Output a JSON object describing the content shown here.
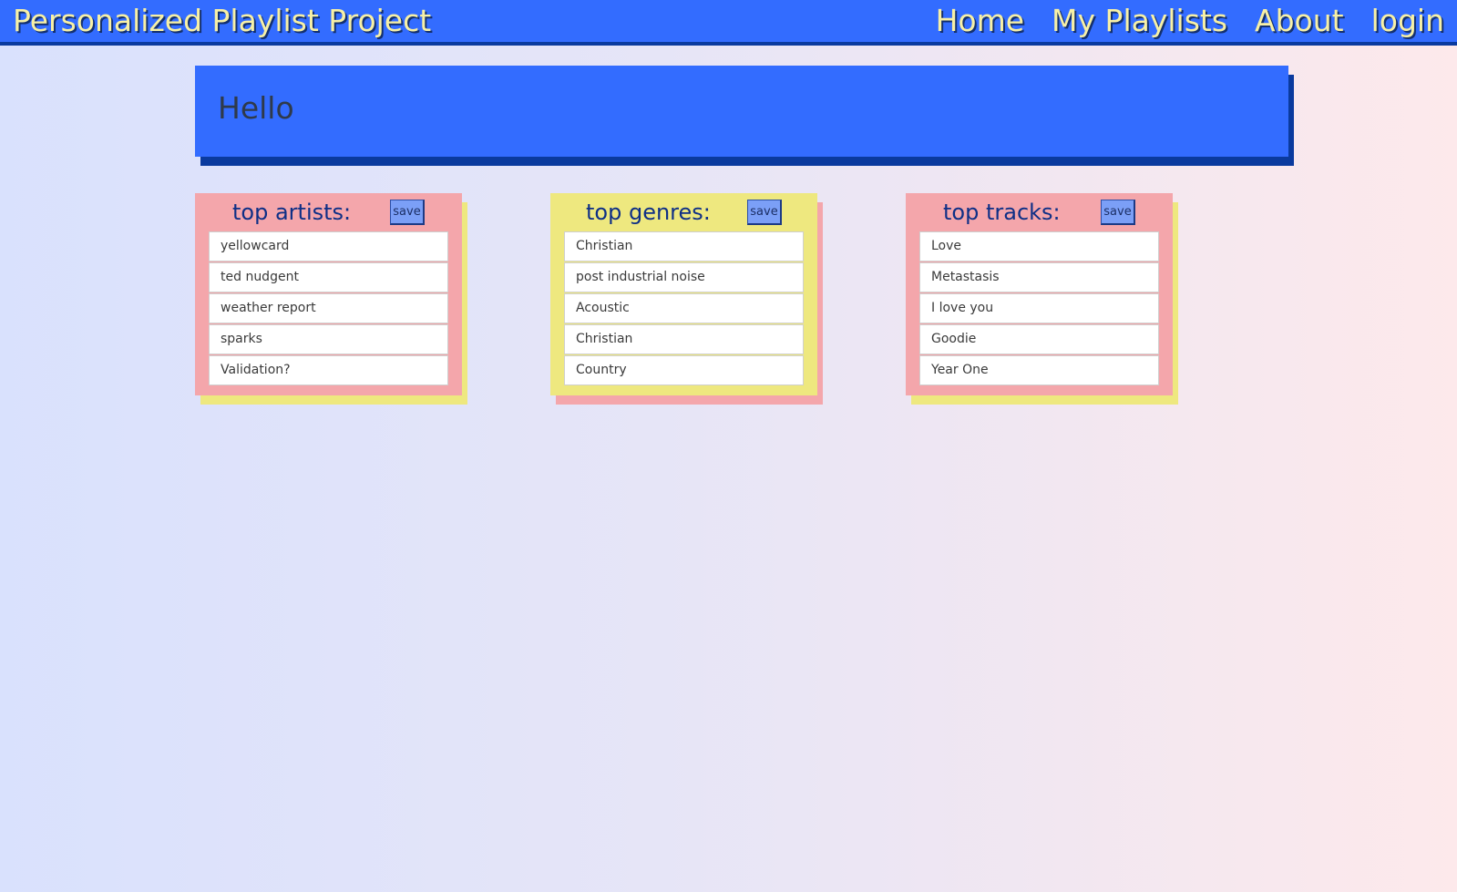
{
  "navbar": {
    "brand": "Personalized Playlist Project",
    "links": [
      "Home",
      "My Playlists",
      "About",
      "login"
    ]
  },
  "hero": {
    "greeting": "Hello"
  },
  "cards": [
    {
      "title": "top artists:",
      "save_label": "save",
      "items": [
        "yellowcard",
        "ted nudgent",
        "weather report",
        "sparks",
        "Validation?"
      ]
    },
    {
      "title": "top genres:",
      "save_label": "save",
      "items": [
        "Christian",
        "post industrial noise",
        "Acoustic",
        "Christian",
        "Country"
      ]
    },
    {
      "title": "top tracks:",
      "save_label": "save",
      "items": [
        "Love",
        "Metastasis",
        "I love you",
        "Goodie",
        "Year One"
      ]
    }
  ],
  "colors": {
    "navbar": "#336cff",
    "navbar_border": "#0a3a9e",
    "nav_text": "#f7f0a6",
    "card_pink": "#f4a6ab",
    "card_yellow": "#eee87f",
    "card_title": "#0e2f86",
    "save_button": "#7b9ff7"
  }
}
